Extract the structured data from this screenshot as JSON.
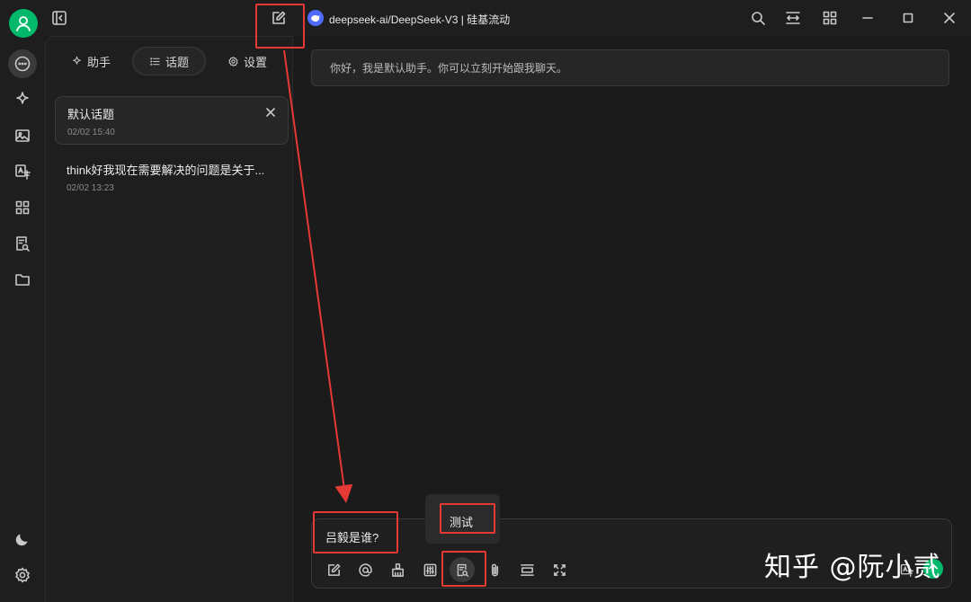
{
  "window": {
    "model_title": "deepseek-ai/DeepSeek-V3 | 硅基流动"
  },
  "sidebar_tabs": {
    "assistant": "助手",
    "topics": "话题",
    "settings": "设置"
  },
  "topics": [
    {
      "title": "默认话题",
      "date": "02/02 15:40"
    },
    {
      "title": "think好我现在需要解决的问题是关于...",
      "date": "02/02 13:23"
    }
  ],
  "chat": {
    "greeting": "你好，我是默认助手。你可以立刻开始跟我聊天。"
  },
  "input": {
    "value": "吕毅是谁?"
  },
  "tooltip": {
    "text": "测试"
  },
  "watermark": {
    "text": "知乎 @阮小贰"
  },
  "colors": {
    "accent": "#00b96b",
    "annotation": "#e53935",
    "model_logo": "#4d6bfe"
  }
}
